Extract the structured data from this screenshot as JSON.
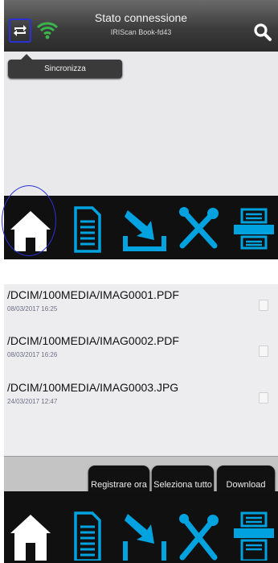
{
  "status": {
    "title": "Stato connessione",
    "device": "IRIScan Book-fd43"
  },
  "tooltip": {
    "label": "Sincronizza"
  },
  "files": [
    {
      "name": "/DCIM/100MEDIA/IMAG0001.PDF",
      "date": "08/03/2017 16:25"
    },
    {
      "name": "/DCIM/100MEDIA/IMAG0002.PDF",
      "date": "08/03/2017 16:26"
    },
    {
      "name": "/DCIM/100MEDIA/IMAG0003.JPG",
      "date": "24/03/2017 12:47"
    }
  ],
  "actions": {
    "register": "Registrare ora",
    "select_all": "Seleziona tutto",
    "download": "Download"
  },
  "icons": {
    "sync": "sync-icon",
    "wifi": "wifi-icon",
    "search": "search-icon",
    "home": "home-icon",
    "document": "document-icon",
    "download": "download-icon",
    "settings": "tools-icon",
    "scanner": "scanner-icon"
  },
  "colors": {
    "accent": "#00a3e0",
    "highlight": "#2a33d6",
    "wifi": "#39b54a"
  }
}
